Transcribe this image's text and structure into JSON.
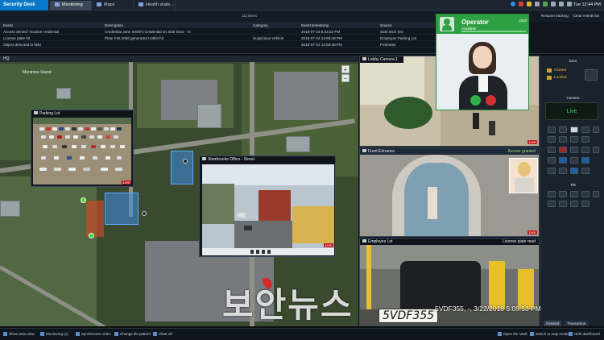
{
  "app": {
    "brand": "Security Desk",
    "tabs": [
      {
        "label": "Monitoring",
        "active": true
      },
      {
        "label": "Maps",
        "active": false
      },
      {
        "label": "Health statis...",
        "active": false
      }
    ],
    "clock": "Tue 12:44 PM"
  },
  "events": {
    "count": "111 items",
    "resume_label": "Resume tracking",
    "clear_label": "Clear events list",
    "columns": [
      "Event",
      "Description",
      "Category",
      "Event timestamp",
      "Source"
    ],
    "rows": [
      [
        "Access denied: Inactive credential",
        "Credential Jane Smith's Credential on Side Door - In",
        "",
        "2018-07-23 5:23:22 PM",
        "Side Door (In)"
      ],
      [
        "License plate hit",
        "Plate FGL3090 generated Hotlist hit",
        "Suspicious Vehicle",
        "2018-07-24 12:56:48 PM",
        "Employee Parking Lot"
      ],
      [
        "Object detected in field",
        "",
        "",
        "2018-07-24 12:56:48 PM",
        "Perimeter"
      ]
    ]
  },
  "map": {
    "header": "HQ",
    "place_label": "Montrose Island",
    "zoom_in": "+",
    "zoom_out": "−"
  },
  "tiles": {
    "parking": {
      "title": "Parking Lot",
      "live": "Live"
    },
    "street": {
      "title": "Sherbrooke Office - Street",
      "live": "Live"
    },
    "lobby": {
      "title": "Lobby Camera 1",
      "live": "Live"
    },
    "entrance": {
      "title": "Front Entrance",
      "status": "Access granted",
      "live": "Live"
    },
    "plate": {
      "title": "Employee Lot",
      "status": "License plate read",
      "plate_text": "5VDF355",
      "caption": "5VDF355, -, 3/22/2018 5:05:53 PM"
    }
  },
  "operator": {
    "name": "Operator",
    "status": "Available",
    "extension": "1003"
  },
  "panel": {
    "door_title": "Door",
    "door_states": [
      "Closed",
      "Locked"
    ],
    "camera_title": "Camera",
    "camera_state": "Live",
    "ptz_title": "Tile",
    "tabs": [
      "General",
      "Transaction"
    ]
  },
  "bottom": {
    "left_buttons": [
      "Show area view",
      "Monitoring (1)",
      "Synchronize video",
      "Change tile pattern",
      "Clear all"
    ],
    "right_buttons": [
      "Open the Vault",
      "Switch to map mode",
      "Hide dashboard"
    ]
  },
  "watermark": "보안뉴스",
  "colors": {
    "accent": "#0a78c8",
    "operator_green": "#2ea043",
    "live_red": "#c2171d",
    "door_yellow": "#f0c238"
  }
}
